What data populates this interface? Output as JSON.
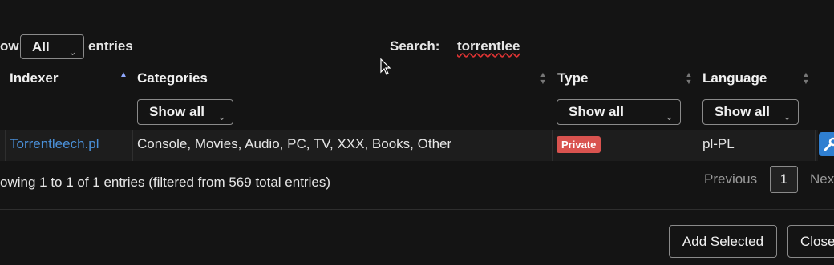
{
  "length_menu": {
    "prefix": "ow",
    "selected": "All",
    "suffix": "entries"
  },
  "search": {
    "label": "Search:",
    "value": "torrentlee"
  },
  "columns": {
    "indexer": "Indexer",
    "categories": "Categories",
    "type": "Type",
    "language": "Language"
  },
  "filters": {
    "categories": "Show all",
    "type": "Show all",
    "language": "Show all"
  },
  "rows": [
    {
      "indexer": "Torrentleech.pl",
      "categories": "Console, Movies, Audio, PC, TV, XXX, Books, Other",
      "type": "Private",
      "language": "pl-PL"
    }
  ],
  "info": "owing 1 to 1 of 1 entries (filtered from 569 total entries)",
  "pagination": {
    "previous": "Previous",
    "current": "1",
    "next": "Nex"
  },
  "footer": {
    "add_selected": "Add Selected",
    "close": "Close"
  },
  "colors": {
    "background": "#141414",
    "link": "#4a90d9",
    "badge_private": "#d9534f",
    "action_button": "#2f7fd1"
  },
  "icons": {
    "sort_asc": "triangle-up-icon",
    "sort_both": "sort-icon",
    "chevron": "chevron-down-icon",
    "config": "wrench-icon"
  }
}
